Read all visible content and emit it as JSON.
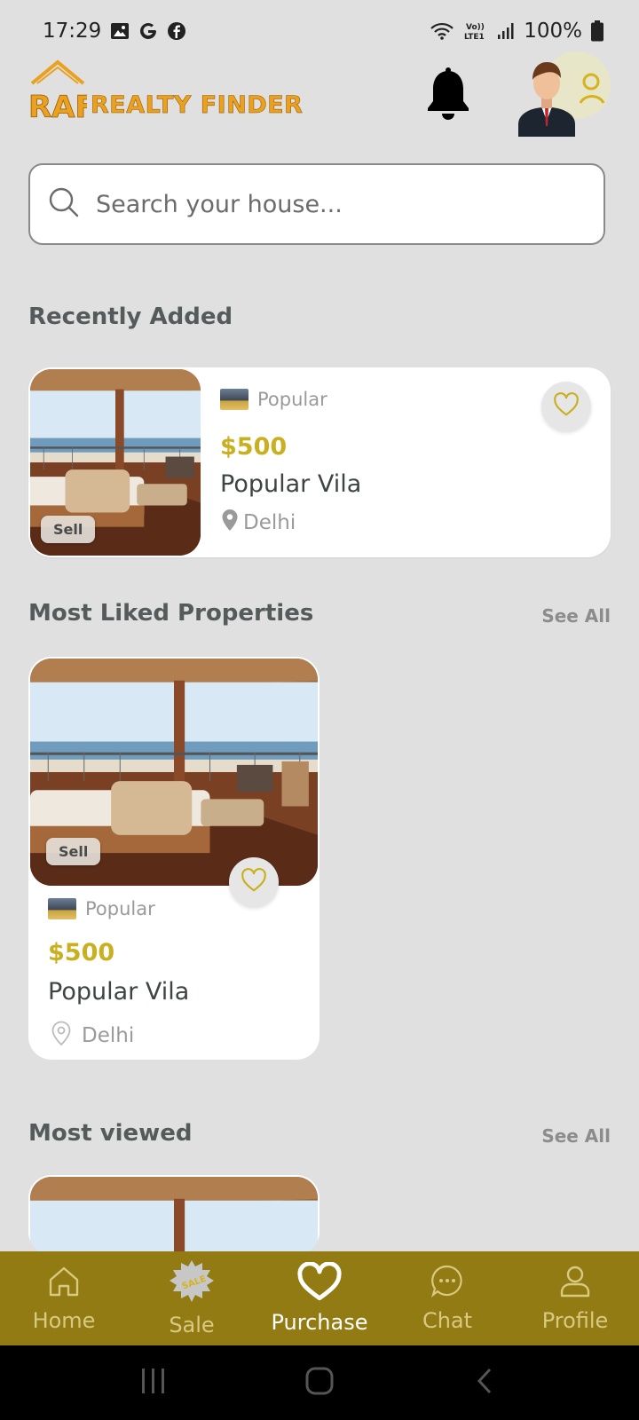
{
  "status_bar": {
    "time": "17:29",
    "battery": "100%"
  },
  "header": {
    "logo_mark": "RAF",
    "logo_text": "REALTY FINDER"
  },
  "search": {
    "placeholder": "Search your house..."
  },
  "sections": {
    "recently_added": {
      "title": "Recently Added"
    },
    "most_liked": {
      "title": "Most Liked Properties",
      "see_all": "See All"
    },
    "most_viewed": {
      "title": "Most viewed",
      "see_all": "See All"
    }
  },
  "recent_card": {
    "tag": "Popular",
    "price": "$500",
    "name": "Popular Vila",
    "location": "Delhi",
    "badge": "Sell"
  },
  "liked_card": {
    "tag": "Popular",
    "price": "$500",
    "name": "Popular Vila",
    "location": "Delhi",
    "badge": "Sell"
  },
  "nav": [
    {
      "label": "Home",
      "icon": "home-icon"
    },
    {
      "label": "Sale",
      "icon": "sale-badge-icon"
    },
    {
      "label": "Purchase",
      "icon": "heart-icon"
    },
    {
      "label": "Chat",
      "icon": "chat-icon"
    },
    {
      "label": "Profile",
      "icon": "person-icon"
    }
  ],
  "colors": {
    "accent": "#927b12",
    "price": "#c8b020",
    "logo": "#e9a11f"
  }
}
